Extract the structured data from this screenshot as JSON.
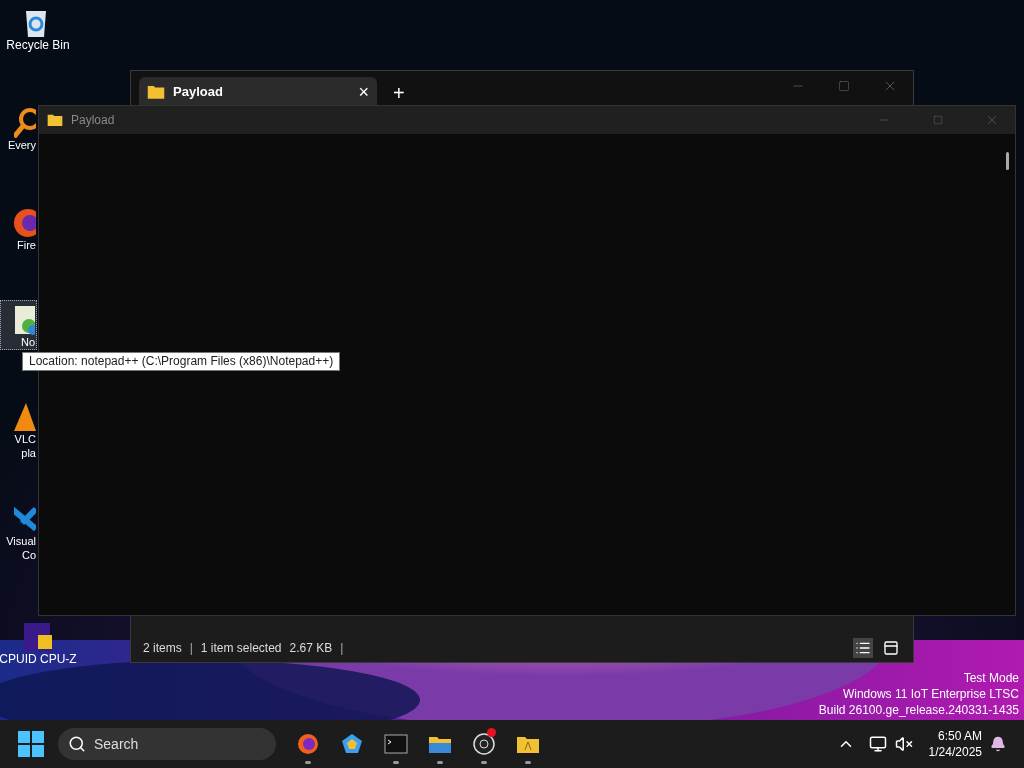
{
  "desktop_icons": [
    {
      "kind": "recycle",
      "lines": [
        "Recycle Bin"
      ],
      "selected": false
    },
    {
      "kind": "magnifier",
      "lines": [
        "Every"
      ],
      "selected": false
    },
    {
      "kind": "browser",
      "lines": [
        "Fire"
      ],
      "selected": false
    },
    {
      "kind": "notepad",
      "lines": [
        "No"
      ],
      "selected": true
    },
    {
      "kind": "cone",
      "lines": [
        "VLC",
        "pla"
      ],
      "selected": false
    },
    {
      "kind": "code",
      "lines": [
        "Visual",
        "Co"
      ],
      "selected": false
    },
    {
      "kind": "chip",
      "lines": [
        "CPUID CPU-Z"
      ],
      "selected": false
    }
  ],
  "explorer_window": {
    "tabs": [
      {
        "label": "Payload",
        "close": "×",
        "selected": true
      }
    ],
    "new_tab": "+",
    "status_bar": {
      "items": "2 items",
      "separators": [
        "|",
        "|"
      ],
      "selection": "1 item selected",
      "size": "2.67 KB"
    },
    "views": [
      {
        "kind": "details",
        "selected": true
      },
      {
        "kind": "preview",
        "selected": false
      }
    ]
  },
  "notepad_window": {
    "title": "Payload"
  },
  "tooltip": "Location: notepad++ (C:\\Program Files (x86)\\Notepad++)",
  "os_notice": [
    "Test Mode",
    "Windows 11 IoT Enterprise LTSC",
    "Build 26100.ge_release.240331-1435"
  ],
  "taskbar": {
    "search": {
      "placeholder": "Search"
    },
    "apps": [
      {
        "kind": "browser",
        "running": true,
        "alert": false
      },
      {
        "kind": "pentagon",
        "running": false,
        "alert": false
      },
      {
        "kind": "terminal",
        "running": true,
        "alert": false
      },
      {
        "kind": "explorer",
        "running": true,
        "alert": false
      },
      {
        "kind": "recorder",
        "running": true,
        "alert": true
      },
      {
        "kind": "folder",
        "running": true,
        "alert": false
      }
    ],
    "time": "6:50 AM",
    "date": "1/24/2025"
  }
}
